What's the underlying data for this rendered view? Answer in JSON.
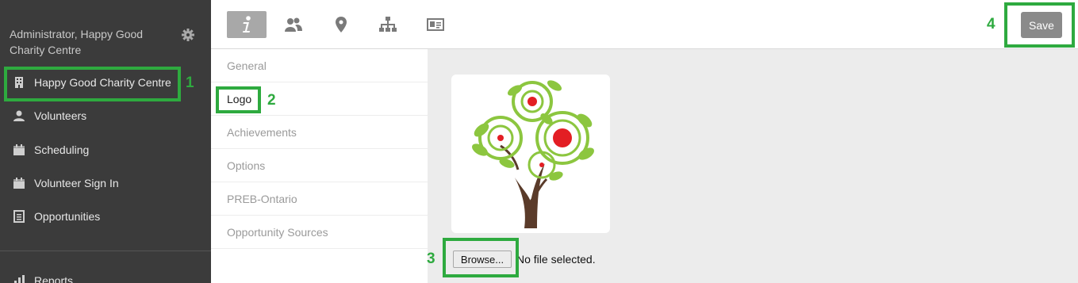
{
  "sidebar": {
    "user_label": "Administrator, Happy Good Charity Centre",
    "items": [
      {
        "label": "Happy Good Charity Centre",
        "icon": "building-icon"
      },
      {
        "label": "Volunteers",
        "icon": "user-icon"
      },
      {
        "label": "Scheduling",
        "icon": "calendar-icon"
      },
      {
        "label": "Volunteer Sign In",
        "icon": "calendar-icon"
      },
      {
        "label": "Opportunities",
        "icon": "list-icon"
      }
    ],
    "bottom_item": "Reports"
  },
  "toolbar": {
    "tabs": [
      {
        "name": "info",
        "icon": "info-icon",
        "active": true
      },
      {
        "name": "people",
        "icon": "people-icon"
      },
      {
        "name": "location",
        "icon": "map-pin-icon"
      },
      {
        "name": "hierarchy",
        "icon": "sitemap-icon"
      },
      {
        "name": "contact-card",
        "icon": "id-card-icon"
      }
    ],
    "save_label": "Save"
  },
  "subnav": {
    "items": [
      {
        "label": "General"
      },
      {
        "label": "Logo",
        "active": true
      },
      {
        "label": "Achievements"
      },
      {
        "label": "Options"
      },
      {
        "label": "PREB-Ontario"
      },
      {
        "label": "Opportunity Sources"
      }
    ]
  },
  "content": {
    "browse_label": "Browse...",
    "file_status": "No file selected."
  },
  "callouts": [
    {
      "number": "1"
    },
    {
      "number": "2"
    },
    {
      "number": "3"
    },
    {
      "number": "4"
    }
  ],
  "colors": {
    "sidebar_bg": "#3b3b3b",
    "callout_green": "#2eaa3f",
    "tab_active_bg": "#a8a8a8",
    "save_bg": "#8a8a8a"
  }
}
